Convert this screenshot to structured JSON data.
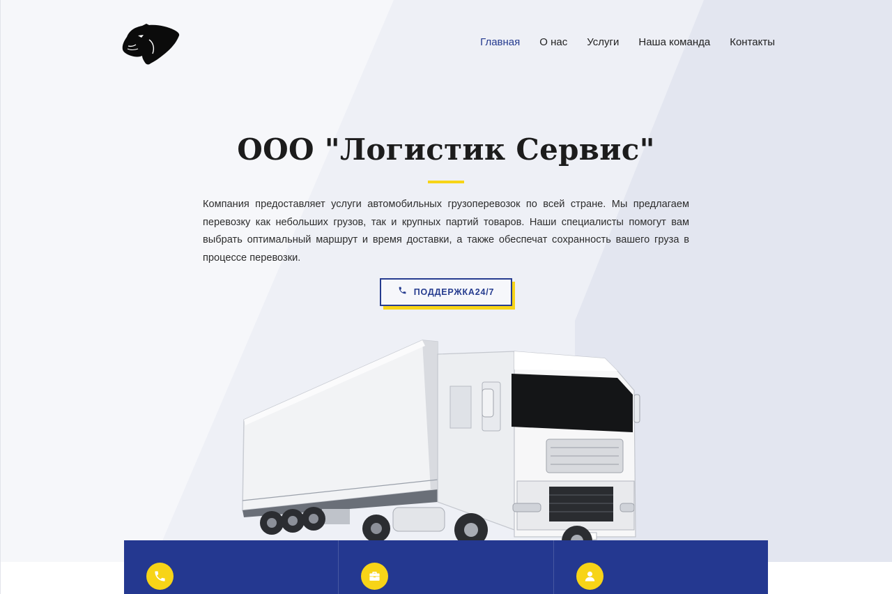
{
  "brand": {
    "logo_icon": "panther-head-icon"
  },
  "nav": {
    "items": [
      {
        "label": "Главная",
        "active": true
      },
      {
        "label": "О нас",
        "active": false
      },
      {
        "label": "Услуги",
        "active": false
      },
      {
        "label": "Наша команда",
        "active": false
      },
      {
        "label": "Контакты",
        "active": false
      }
    ]
  },
  "hero": {
    "title": "ООО \"Логистик Сервис\"",
    "description": "Компания предоставляет услуги автомобильных грузоперевозок по всей стране. Мы предлагаем перевозку как небольших грузов, так и крупных партий товаров. Наши специалисты помогут вам выбрать оптимальный маршрут и время доставки, а также обеспечат сохранность вашего груза в процессе перевозки.",
    "cta_label": "ПОДДЕРЖКА24/7",
    "cta_icon": "phone-icon"
  },
  "features": [
    {
      "icon": "phone-icon"
    },
    {
      "icon": "briefcase-icon"
    },
    {
      "icon": "user-icon"
    }
  ],
  "colors": {
    "accent_blue": "#243890",
    "accent_yellow": "#f7d417",
    "nav_active": "#243a8f",
    "background": "#f6f7fa"
  }
}
